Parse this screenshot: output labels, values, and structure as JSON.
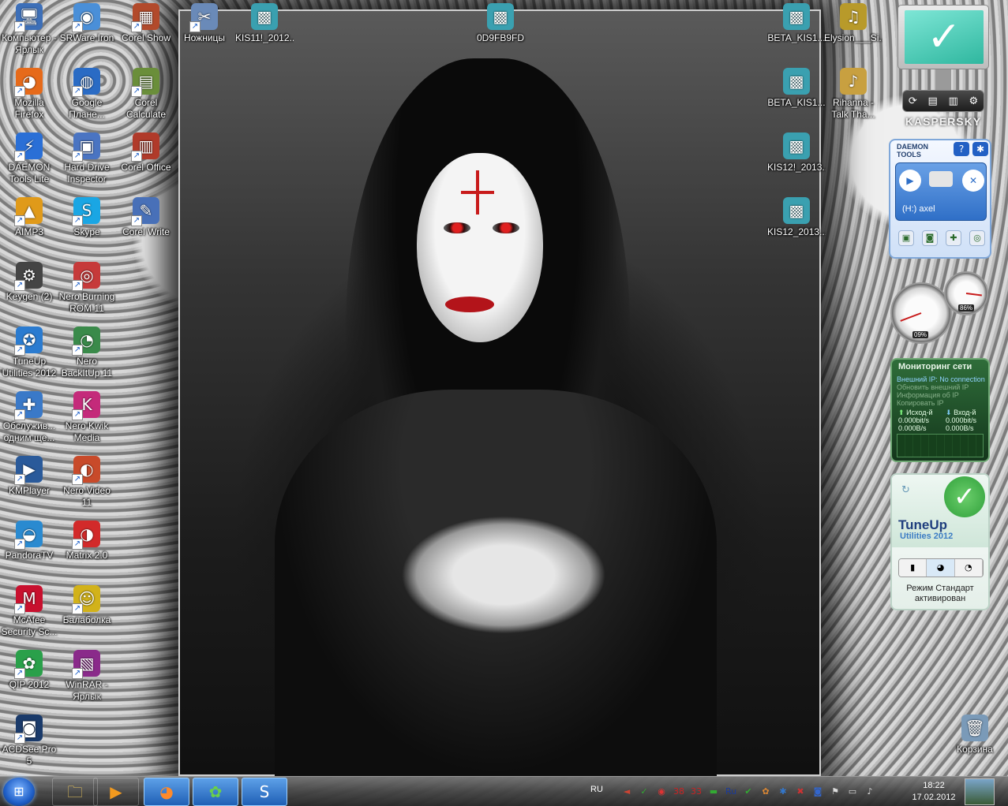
{
  "desktop": {
    "icons": [
      {
        "label": "Компьютер - Ярлык",
        "glyph": "🖥",
        "color": "#3d6fb8"
      },
      {
        "label": "SRWare Iron",
        "glyph": "◉",
        "color": "#4a8fd8"
      },
      {
        "label": "Corel Show",
        "glyph": "▦",
        "color": "#b24a2b"
      },
      {
        "label": "Mozilla Firefox",
        "glyph": "◕",
        "color": "#e66a1a"
      },
      {
        "label": "Google Плане...",
        "glyph": "◍",
        "color": "#2a6bc4"
      },
      {
        "label": "Corel Calculate",
        "glyph": "▤",
        "color": "#6a8e3a"
      },
      {
        "label": "DAEMON Tools Lite",
        "glyph": "⚡",
        "color": "#2a6fd6"
      },
      {
        "label": "Hard Drive Inspector",
        "glyph": "▣",
        "color": "#4a74c2"
      },
      {
        "label": "Corel Office",
        "glyph": "▥",
        "color": "#b03a2a"
      },
      {
        "label": "AIMP3",
        "glyph": "▲",
        "color": "#e09a1a"
      },
      {
        "label": "Skype",
        "glyph": "S",
        "color": "#1aa6e4"
      },
      {
        "label": "Corel Write",
        "glyph": "✎",
        "color": "#4870b8"
      },
      {
        "label": "Keygen (2)",
        "glyph": "⚙",
        "color": "#444444"
      },
      {
        "label": "Nero Burning ROM 11",
        "glyph": "◎",
        "color": "#c63a3a"
      },
      {
        "label": "TuneUp Utilities 2012",
        "glyph": "✪",
        "color": "#2a7bd0"
      },
      {
        "label": "Nero BackItUp 11",
        "glyph": "◔",
        "color": "#3a8a4a"
      },
      {
        "label": "Обслужив... одним ще...",
        "glyph": "✚",
        "color": "#3a79c8"
      },
      {
        "label": "Nero Kwik Media",
        "glyph": "K",
        "color": "#c42a7a"
      },
      {
        "label": "KMPlayer",
        "glyph": "▶",
        "color": "#2a5a9a"
      },
      {
        "label": "Nero Video 11",
        "glyph": "◐",
        "color": "#c84a2a"
      },
      {
        "label": "PandoraTV",
        "glyph": "◒",
        "color": "#2a8ad0"
      },
      {
        "label": "Matrix 2.0",
        "glyph": "◑",
        "color": "#d22a2a"
      },
      {
        "label": "McAfee Security Sc...",
        "glyph": "M",
        "color": "#c8102e"
      },
      {
        "label": "Балаболка",
        "glyph": "☺",
        "color": "#d2b21a"
      },
      {
        "label": "QIP 2012",
        "glyph": "✿",
        "color": "#2aa04a"
      },
      {
        "label": "WinRAR - Ярлык",
        "glyph": "▧",
        "color": "#8a2a8a"
      },
      {
        "label": "ACDSee Pro 5",
        "glyph": "◙",
        "color": "#1a3a6a"
      },
      {
        "label": "Ножницы",
        "glyph": "✂",
        "color": "#6a8ab8"
      },
      {
        "label": "KIS11!_2012...",
        "glyph": "▩",
        "color": "#3aa0b0"
      },
      {
        "label": "0D9FB9FD",
        "glyph": "▩",
        "color": "#3aa0b0"
      },
      {
        "label": "BETA_KIS1...",
        "glyph": "▩",
        "color": "#3aa0b0"
      },
      {
        "label": "Elysion___Si...",
        "glyph": "♫",
        "color": "#b89a2a"
      },
      {
        "label": "BETA_KIS1...",
        "glyph": "▩",
        "color": "#3aa0b0"
      },
      {
        "label": "Rihanna - Talk Tha...",
        "glyph": "♪",
        "color": "#c8a040"
      },
      {
        "label": "KIS12!_2013...",
        "glyph": "▩",
        "color": "#3aa0b0"
      },
      {
        "label": "KIS12_2013...",
        "glyph": "▩",
        "color": "#3aa0b0"
      },
      {
        "label": "Корзина",
        "glyph": "🗑",
        "color": "#7a9ab8"
      }
    ]
  },
  "gadgets": {
    "kaspersky": {
      "brand": "KASPERSKY",
      "status_icon": "check-icon",
      "buttons": [
        "⟳",
        "▤",
        "▥",
        "⚙"
      ]
    },
    "daemon": {
      "title_line1": "DAEMON",
      "title_line2": "TOOLS",
      "help": "?",
      "drive": "(H:) axel"
    },
    "cpu": {
      "cpu_value": "09%",
      "ram_value": "86%",
      "cpu_level": 0.09,
      "ram_level": 0.86
    },
    "netmon": {
      "title": "Мониторинг сети",
      "external_ip": "Внешний IP: No connection",
      "refresh_ip": "Обновить внешний IP",
      "ip_info": "Информация об IP",
      "copy_ip": "Копировать IP",
      "out_label": "Исход-й",
      "in_label": "Вход-й",
      "out_bits": "0.000bit/s",
      "in_bits": "0.000bit/s",
      "out_bytes": "0.000B/s",
      "in_bytes": "0.000B/s"
    },
    "tuneup": {
      "name": "TuneUp",
      "version": "Utilities 2012",
      "status_line1": "Режим Стандарт",
      "status_line2": "активирован"
    }
  },
  "taskbar": {
    "language": "RU",
    "time": "18:22",
    "date": "17.02.2012",
    "pinned": [
      {
        "name": "explorer",
        "glyph": "🗀",
        "color": "#e8c45a"
      },
      {
        "name": "media-player",
        "glyph": "▶",
        "color": "#f29a1e"
      },
      {
        "name": "firefox",
        "glyph": "◕",
        "color": "#ff8a2a"
      },
      {
        "name": "qip",
        "glyph": "✿",
        "color": "#6ad04a"
      },
      {
        "name": "skype",
        "glyph": "S",
        "color": "#ffffff"
      }
    ],
    "tray": [
      {
        "glyph": "◄",
        "color": "#c43"
      },
      {
        "glyph": "✓",
        "color": "#3a3"
      },
      {
        "glyph": "◉",
        "color": "#d33"
      },
      {
        "glyph": "38",
        "color": "#c22"
      },
      {
        "glyph": "33",
        "color": "#c22"
      },
      {
        "glyph": "▬",
        "color": "#3a3"
      },
      {
        "glyph": "Ru",
        "color": "#1a3a9a"
      },
      {
        "glyph": "✔",
        "color": "#3a3"
      },
      {
        "glyph": "✿",
        "color": "#d83"
      },
      {
        "glyph": "✱",
        "color": "#37c"
      },
      {
        "glyph": "✖",
        "color": "#c33"
      },
      {
        "glyph": "◙",
        "color": "#36c"
      },
      {
        "glyph": "⚑",
        "color": "#ddd"
      },
      {
        "glyph": "▭",
        "color": "#ddd"
      },
      {
        "glyph": "♪",
        "color": "#ddd"
      }
    ]
  }
}
